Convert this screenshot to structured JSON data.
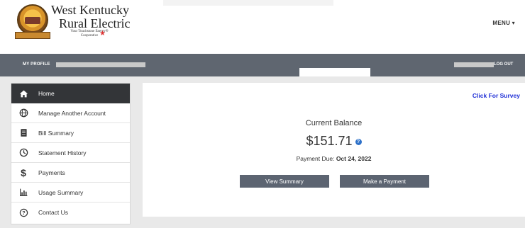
{
  "header": {
    "logo_line1": "West Kentucky",
    "logo_line2": "Rural Electric",
    "logo_tagline": "Your Touchstone Energy® Cooperative",
    "menu_label": "MENU ▾"
  },
  "profile_bar": {
    "my_profile_label": "MY PROFILE",
    "logout_label": "LOG OUT"
  },
  "sidebar": {
    "items": [
      {
        "label": "Home",
        "icon": "home-icon",
        "active": true
      },
      {
        "label": "Manage Another Account",
        "icon": "globe-icon"
      },
      {
        "label": "Bill Summary",
        "icon": "document-icon"
      },
      {
        "label": "Statement History",
        "icon": "clock-icon"
      },
      {
        "label": "Payments",
        "icon": "dollar-icon"
      },
      {
        "label": "Usage Summary",
        "icon": "bar-chart-icon"
      },
      {
        "label": "Contact Us",
        "icon": "question-icon"
      }
    ]
  },
  "main": {
    "survey_link": "Click For Survey",
    "balance_title": "Current Balance",
    "balance_amount": "$151.71",
    "payment_due_label": "Payment Due:",
    "payment_due_date": "Oct 24, 2022",
    "view_summary_label": "View Summary",
    "make_payment_label": "Make a Payment"
  },
  "colors": {
    "profile_bar": "#5f6670",
    "sidebar_active": "#333538",
    "button": "#5c6471",
    "survey_link": "#1f2fd6",
    "info_icon": "#2f72c9"
  }
}
